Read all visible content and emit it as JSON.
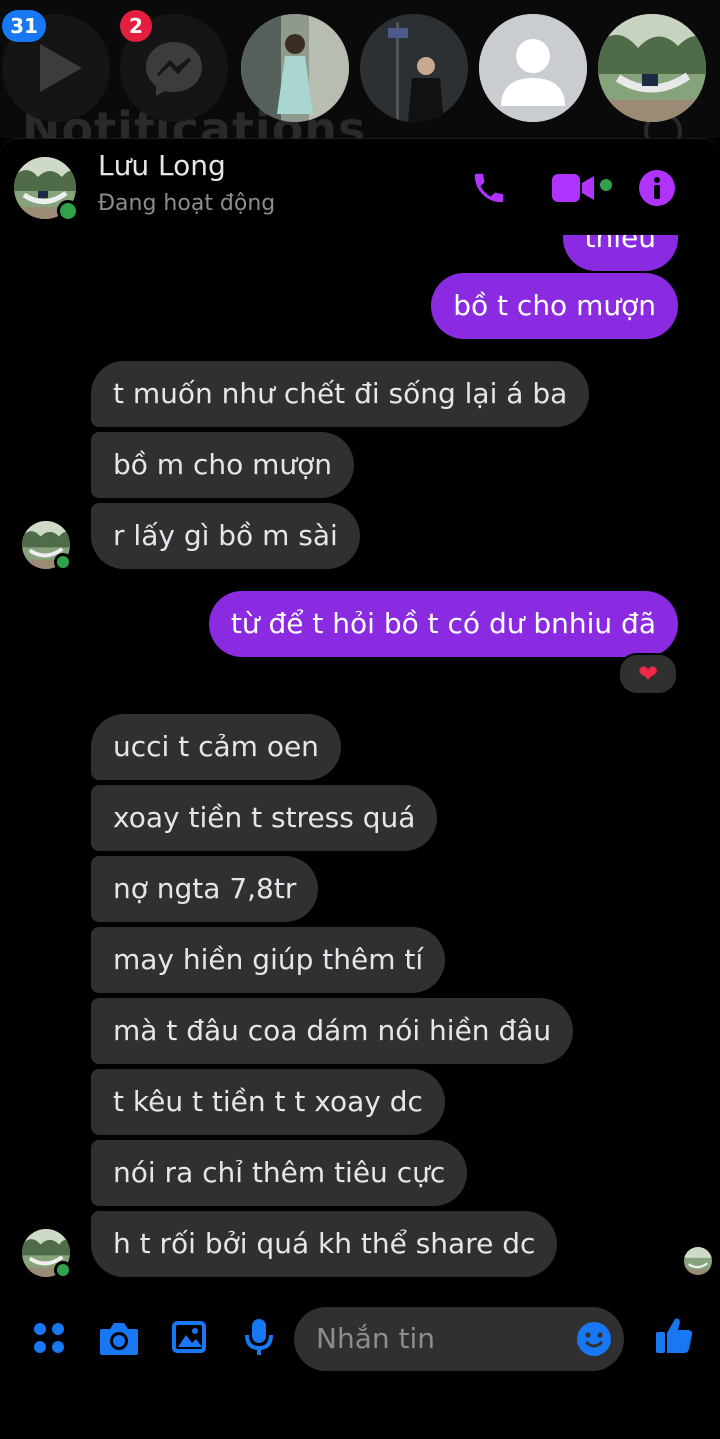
{
  "chat_heads": {
    "background_title": "Notifications",
    "items": [
      {
        "name": "video-head",
        "badge": "31"
      },
      {
        "name": "messenger-head",
        "badge": "2"
      },
      {
        "name": "contact-girl-dress"
      },
      {
        "name": "contact-boy-night"
      },
      {
        "name": "contact-default-avatar"
      },
      {
        "name": "contact-hammock"
      }
    ]
  },
  "header": {
    "name": "Lưu Long",
    "status": "Đang hoạt động",
    "accent": "#b133ff"
  },
  "messages": [
    {
      "side": "out",
      "text": "thiếu"
    },
    {
      "side": "out",
      "text": "bồ t cho mượn"
    },
    {
      "side": "in",
      "text": "t muốn như chết đi sống lại á ba"
    },
    {
      "side": "in",
      "text": "bồ m cho mượn"
    },
    {
      "side": "in",
      "text": "r lấy gì bồ m sài"
    },
    {
      "side": "out",
      "text": "từ để t hỏi bồ t có dư bnhiu đã",
      "reaction": "❤"
    },
    {
      "side": "in",
      "text": "ucci t cảm oen"
    },
    {
      "side": "in",
      "text": "xoay tiền t stress quá"
    },
    {
      "side": "in",
      "text": "nợ ngta 7,8tr"
    },
    {
      "side": "in",
      "text": "may hiền giúp thêm tí"
    },
    {
      "side": "in",
      "text": "mà t đâu coa dám nói hiền đâu"
    },
    {
      "side": "in",
      "text": "t kêu t tiền t t xoay dc"
    },
    {
      "side": "in",
      "text": "nói ra chỉ thêm tiêu cực"
    },
    {
      "side": "in",
      "text": "h t rối bởi quá kh thể share dc"
    }
  ],
  "composer": {
    "placeholder": "Nhắn tin",
    "accent": "#1877f2"
  }
}
